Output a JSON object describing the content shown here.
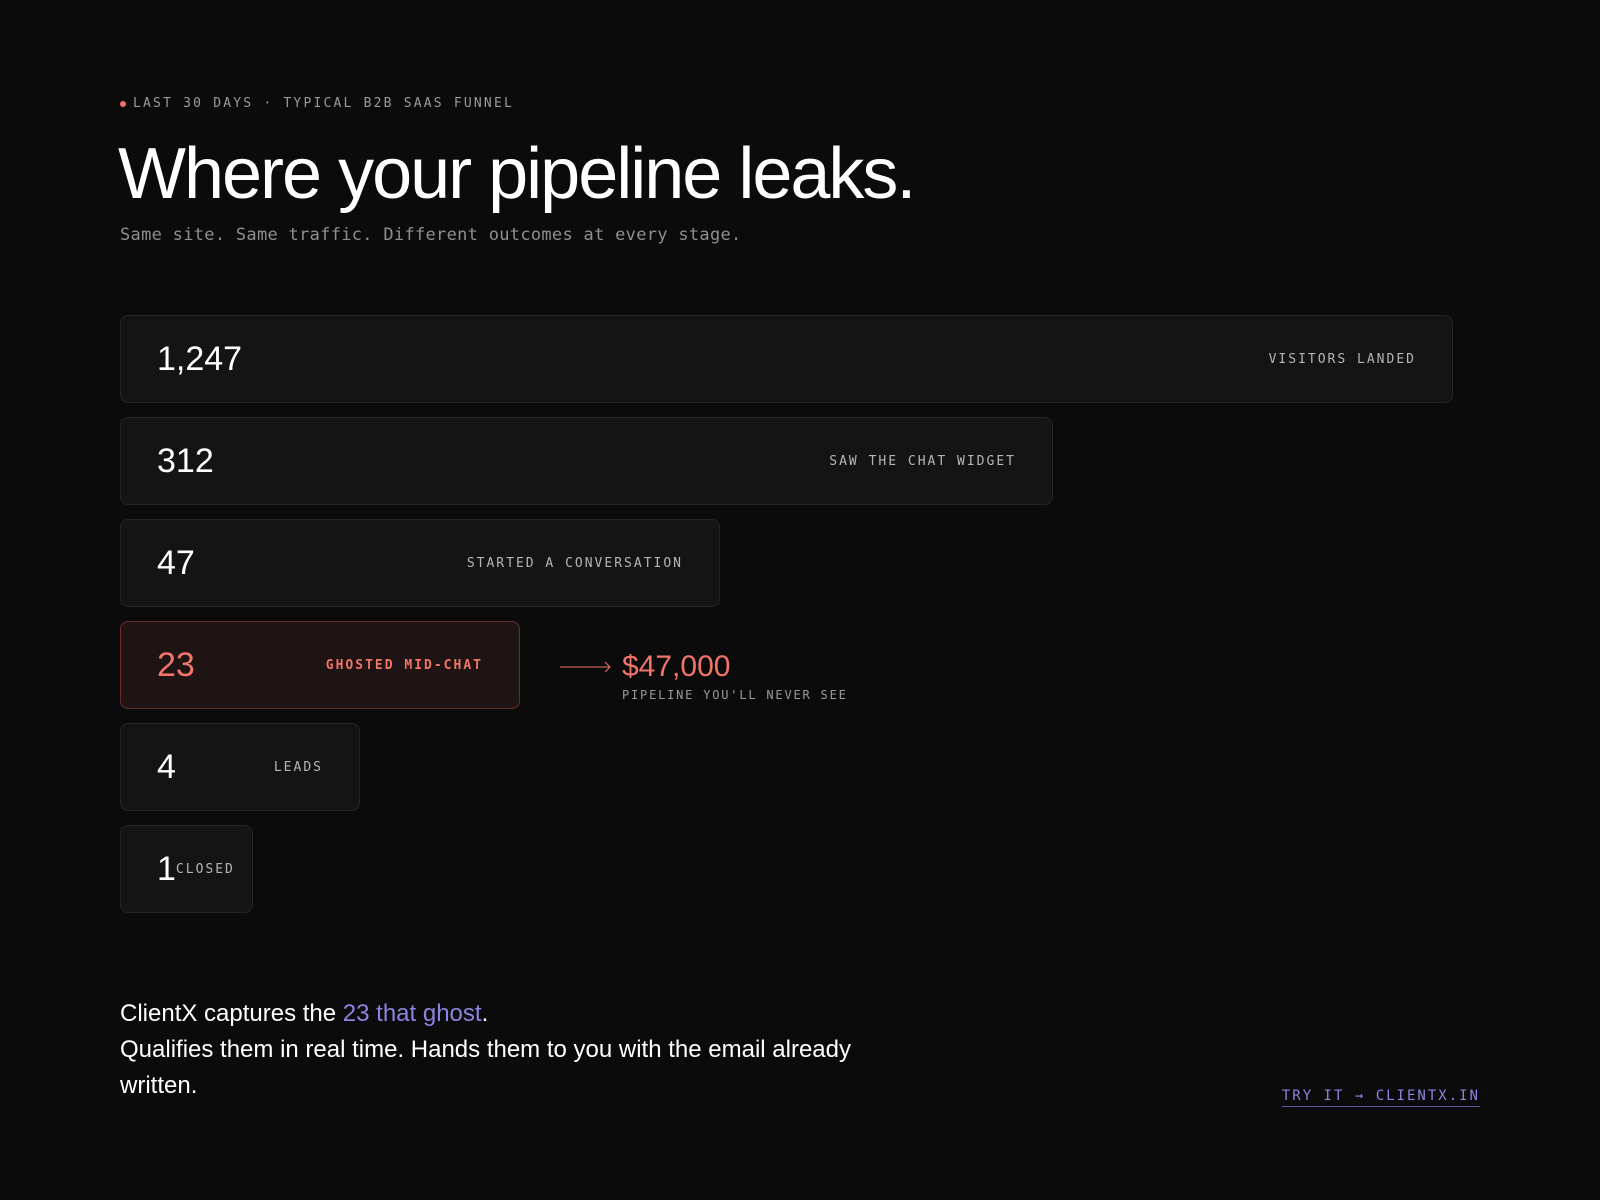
{
  "eyebrow": "LAST 30 DAYS · TYPICAL B2B SAAS FUNNEL",
  "headline": "Where your pipeline leaks.",
  "subtitle": "Same site. Same traffic. Different outcomes at every stage.",
  "funnel": [
    {
      "value": "1,247",
      "label": "VISITORS LANDED"
    },
    {
      "value": "312",
      "label": "SAW THE CHAT WIDGET"
    },
    {
      "value": "47",
      "label": "STARTED A CONVERSATION"
    },
    {
      "value": "23",
      "label": "GHOSTED MID-CHAT"
    },
    {
      "value": "4",
      "label": "LEADS"
    },
    {
      "value": "1",
      "label": "CLOSED"
    }
  ],
  "leak_callout": {
    "amount": "$47,000",
    "caption": "PIPELINE YOU'LL NEVER SEE"
  },
  "footer": {
    "line1_prefix": "ClientX captures the ",
    "line1_highlight": "23 that ghost",
    "line1_suffix": ".",
    "line2": "Qualifies them in real time. Hands them to you with the email already written."
  },
  "cta": "TRY IT → CLIENTX.IN",
  "colors": {
    "background": "#0b0b0b",
    "leak_accent": "#f07468",
    "brand_accent": "#8c84e0"
  }
}
